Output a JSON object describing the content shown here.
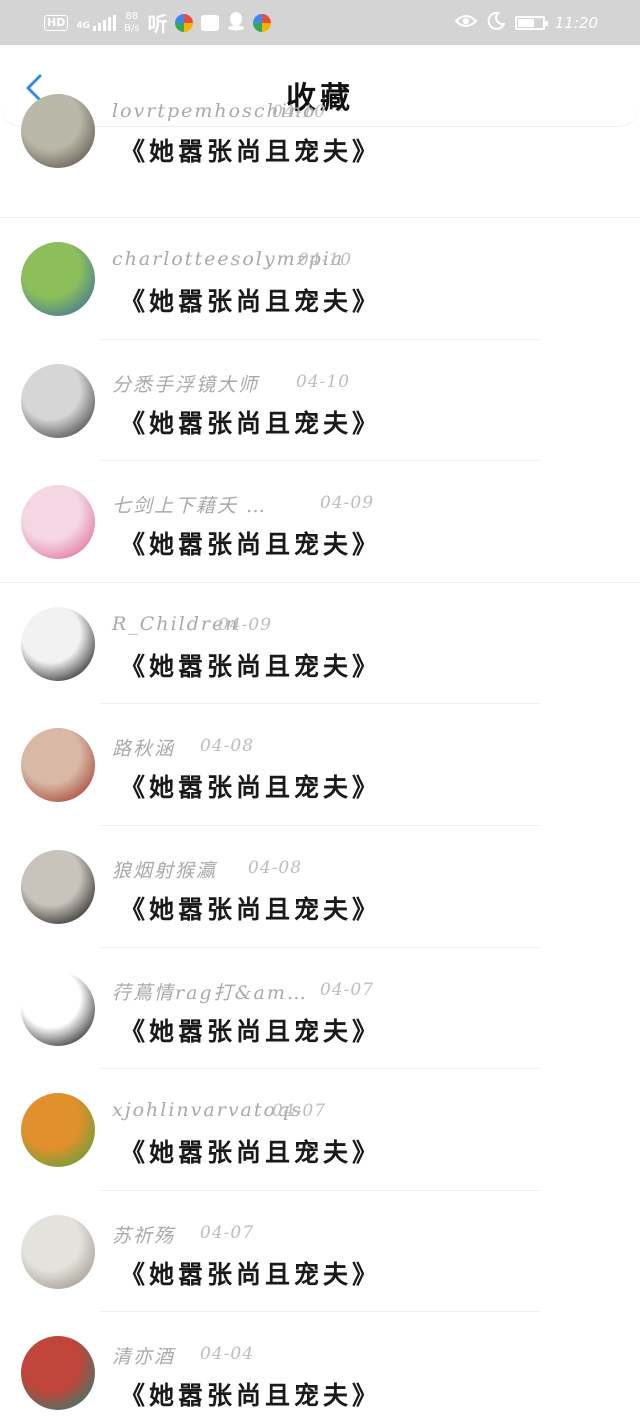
{
  "status_bar": {
    "hd": "HD",
    "network": "4G",
    "speed_value": "88",
    "speed_unit": "B/s",
    "ting": "听",
    "time": "11:20",
    "battery_level": 0.7,
    "icons": [
      "hd-icon",
      "signal-icon",
      "ting-app-icon",
      "colorful-app-icon",
      "message-app-icon",
      "qq-icon",
      "colorful-app-icon",
      "eye-icon",
      "moon-icon",
      "battery-icon"
    ]
  },
  "header": {
    "title": "收藏",
    "back_icon": "chevron-left-icon",
    "accent": "#2f8be6"
  },
  "favorites": [
    {
      "user": "lovrtpemhoschino",
      "date": "04-10",
      "book": "《她嚣张尚且宠夫》",
      "avatar_colors": [
        "#b9b7a8",
        "#5a5148"
      ]
    },
    {
      "user": "charlotteesolymzpia",
      "date": "04-10",
      "book": "《她嚣张尚且宠夫》",
      "avatar_colors": [
        "#8cbf5c",
        "#3e6e9c"
      ]
    },
    {
      "user": "分悉手浮镜大师",
      "date": "04-10",
      "book": "《她嚣张尚且宠夫》",
      "avatar_colors": [
        "#d6d6d6",
        "#3a3a3a"
      ]
    },
    {
      "user": "七剑上下藉夭 …",
      "date": "04-09",
      "book": "《她嚣张尚且宠夫》",
      "avatar_colors": [
        "#f4d7e2",
        "#e06a9b"
      ]
    },
    {
      "user": "R_Children",
      "date": "04-09",
      "book": "《她嚣张尚且宠夫》",
      "avatar_colors": [
        "#f2f2f2",
        "#111111"
      ]
    },
    {
      "user": "路秋涵",
      "date": "04-08",
      "book": "《她嚣张尚且宠夫》",
      "avatar_colors": [
        "#d9b9a6",
        "#a33a2e"
      ]
    },
    {
      "user": "狼烟射猴瀛",
      "date": "04-08",
      "book": "《她嚣张尚且宠夫》",
      "avatar_colors": [
        "#c8c3bb",
        "#1c1c1c"
      ]
    },
    {
      "user": "荇蔦情rag打&am…",
      "date": "04-07",
      "book": "《她嚣张尚且宠夫》",
      "avatar_colors": [
        "#ffffff",
        "#111111"
      ]
    },
    {
      "user": "xjohlinvarvatoqs",
      "date": "04-07",
      "book": "《她嚣张尚且宠夫》",
      "avatar_colors": [
        "#e0902c",
        "#5aa23a"
      ]
    },
    {
      "user": "苏祈殇",
      "date": "04-07",
      "book": "《她嚣张尚且宠夫》",
      "avatar_colors": [
        "#e4e2dc",
        "#9a938a"
      ]
    },
    {
      "user": "清亦酒",
      "date": "04-04",
      "book": "《她嚣张尚且宠夫》",
      "avatar_colors": [
        "#c0453a",
        "#2f7f74"
      ]
    }
  ]
}
